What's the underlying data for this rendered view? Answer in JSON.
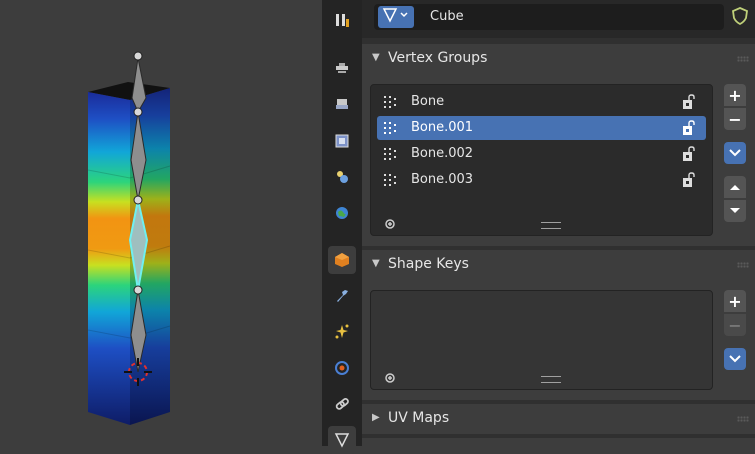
{
  "header": {
    "datablock_icon": "mesh-data-icon",
    "object_name": "Cube",
    "fake_user_icon": "shield-icon"
  },
  "vertex_groups": {
    "title": "Vertex Groups",
    "items": [
      {
        "label": "Bone",
        "selected": false
      },
      {
        "label": "Bone.001",
        "selected": true
      },
      {
        "label": "Bone.002",
        "selected": false
      },
      {
        "label": "Bone.003",
        "selected": false
      }
    ],
    "add_icon": "plus-icon",
    "remove_icon": "minus-icon",
    "specials_icon": "chevron-down-icon",
    "move_up_icon": "triangle-up-icon",
    "move_down_icon": "triangle-down-icon"
  },
  "shape_keys": {
    "title": "Shape Keys",
    "add_icon": "plus-icon",
    "remove_icon": "minus-icon",
    "specials_icon": "chevron-down-icon"
  },
  "uv_maps": {
    "title": "UV Maps"
  },
  "tabs": [
    "tool-icon",
    "render-icon",
    "output-icon",
    "view-layer-icon",
    "scene-icon",
    "world-icon",
    "object-icon",
    "modifier-icon",
    "particles-icon",
    "physics-icon",
    "constraints-icon",
    "mesh-data-icon"
  ],
  "colors": {
    "accent": "#4772b3",
    "panel": "#3d3d3d",
    "background": "#303030",
    "tab_bar": "#242424"
  }
}
